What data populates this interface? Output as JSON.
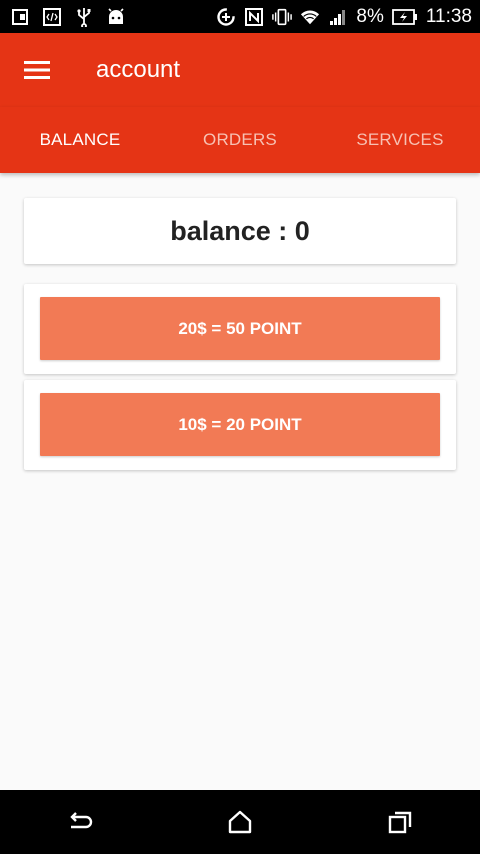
{
  "status_bar": {
    "battery_percent": "8%",
    "time": "11:38",
    "icons": [
      "screenshot-icon",
      "code-icon",
      "usb-icon",
      "android-icon",
      "data-saver-icon",
      "nfc-icon",
      "vibrate-icon",
      "wifi-icon",
      "signal-icon",
      "battery-charging-icon"
    ]
  },
  "app_bar": {
    "title": "account",
    "menu_icon": "hamburger-menu-icon"
  },
  "tabs": [
    {
      "label": "BALANCE",
      "active": true
    },
    {
      "label": "ORDERS",
      "active": false
    },
    {
      "label": "SERVICES",
      "active": false
    }
  ],
  "balance": {
    "text": "balance : 0"
  },
  "offers": [
    {
      "label": "20$ = 50 POINT"
    },
    {
      "label": "10$ = 20 POINT"
    }
  ],
  "nav_bar": {
    "icons": [
      "back-icon",
      "home-icon",
      "recents-icon"
    ]
  },
  "colors": {
    "primary": "#e53415",
    "accent_button": "#f27a55",
    "background": "#fafafa"
  }
}
